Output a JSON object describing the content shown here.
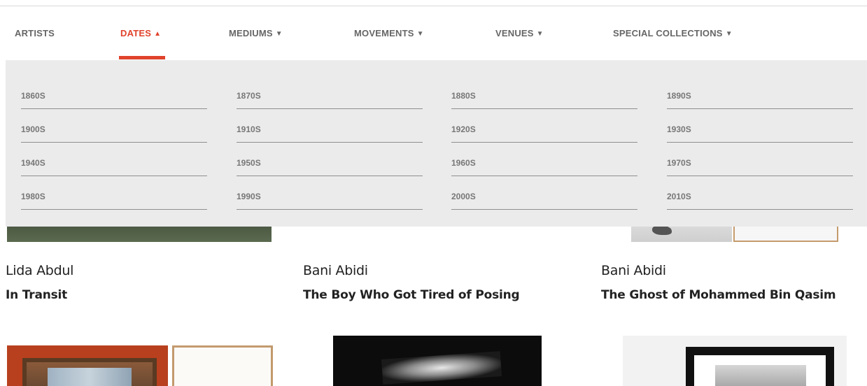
{
  "nav": {
    "items": [
      {
        "label": "ARTISTS",
        "caret": ""
      },
      {
        "label": "DATES",
        "caret": "▲"
      },
      {
        "label": "MEDIUMS",
        "caret": "▼"
      },
      {
        "label": "MOVEMENTS",
        "caret": "▼"
      },
      {
        "label": "VENUES",
        "caret": "▼"
      },
      {
        "label": "SPECIAL COLLECTIONS",
        "caret": "▼"
      }
    ],
    "active": "DATES",
    "accent_color": "#e0432c"
  },
  "dates_dropdown": {
    "items": [
      "1860S",
      "1870S",
      "1880S",
      "1890S",
      "1900S",
      "1910S",
      "1920S",
      "1930S",
      "1940S",
      "1950S",
      "1960S",
      "1970S",
      "1980S",
      "1990S",
      "2000S",
      "2010S"
    ]
  },
  "artworks": [
    {
      "artist": "Lida Abdul",
      "title": "In Transit"
    },
    {
      "artist": "Bani Abidi",
      "title": "The Boy Who Got Tired of Posing"
    },
    {
      "artist": "Bani Abidi",
      "title": "The Ghost of Mohammed Bin Qasim"
    }
  ]
}
